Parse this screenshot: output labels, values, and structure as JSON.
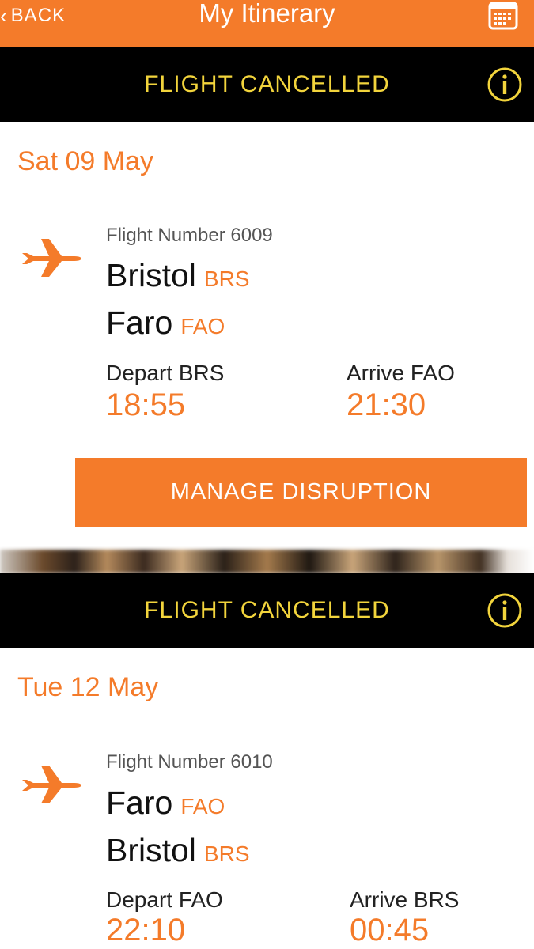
{
  "header": {
    "back_label": "BACK",
    "title": "My Itinerary"
  },
  "colors": {
    "accent": "#f47b2a",
    "banner_bg": "#000000",
    "banner_text": "#f2d43c"
  },
  "flights": [
    {
      "status": "FLIGHT CANCELLED",
      "date": "Sat 09 May",
      "flight_number": "Flight Number 6009",
      "origin_city": "Bristol",
      "origin_code": "BRS",
      "dest_city": "Faro",
      "dest_code": "FAO",
      "depart_label": "Depart BRS",
      "depart_time": "18:55",
      "arrive_label": "Arrive FAO",
      "arrive_time": "21:30",
      "action_label": "MANAGE DISRUPTION"
    },
    {
      "status": "FLIGHT CANCELLED",
      "date": "Tue 12 May",
      "flight_number": "Flight Number 6010",
      "origin_city": "Faro",
      "origin_code": "FAO",
      "dest_city": "Bristol",
      "dest_code": "BRS",
      "depart_label": "Depart FAO",
      "depart_time": "22:10",
      "arrive_label": "Arrive BRS",
      "arrive_time": "00:45"
    }
  ]
}
